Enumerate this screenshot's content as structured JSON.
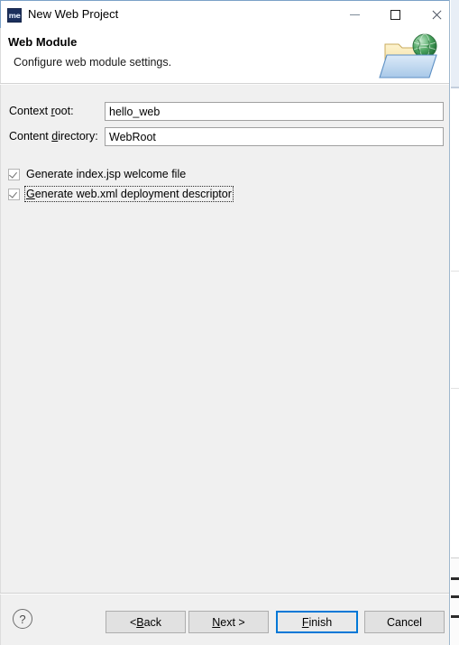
{
  "window": {
    "title": "New Web Project",
    "icon_name": "myeclipse-icon",
    "icon_text": "me",
    "controls": {
      "minimize": "—",
      "maximize": "□",
      "close": "✕"
    }
  },
  "header": {
    "title": "Web Module",
    "description": "Configure web module settings.",
    "banner_icon": "folder-globe-icon"
  },
  "form": {
    "fields": [
      {
        "label_before": "Context ",
        "label_mnemonic": "r",
        "label_after": "oot:",
        "value": "hello_web",
        "placeholder": ""
      },
      {
        "label_before": "Content ",
        "label_mnemonic": "d",
        "label_after": "irectory:",
        "value": "WebRoot",
        "placeholder": ""
      }
    ],
    "checkboxes": [
      {
        "label_before": "",
        "label_mnemonic": "",
        "label_after": "Generate index.jsp welcome file",
        "checked": true,
        "focused": false
      },
      {
        "label_before": "",
        "label_mnemonic": "G",
        "label_after": "enerate web.xml deployment descriptor",
        "checked": true,
        "focused": true
      }
    ]
  },
  "footer": {
    "help_glyph": "?",
    "buttons": [
      {
        "name": "back",
        "before": "< ",
        "mnemonic": "B",
        "after": "ack",
        "default": false
      },
      {
        "name": "next",
        "before": "",
        "mnemonic": "N",
        "after": "ext >",
        "default": false
      },
      {
        "name": "finish",
        "before": "",
        "mnemonic": "F",
        "after": "inish",
        "default": true
      },
      {
        "name": "cancel",
        "before": "Cancel",
        "mnemonic": "",
        "after": "",
        "default": false
      }
    ]
  },
  "colors": {
    "accent": "#0078d7",
    "dialog_bg": "#f0f0f0",
    "titlebar_bg": "#ffffff",
    "field_bg": "#ffffff",
    "button_bg": "#e1e1e1"
  }
}
